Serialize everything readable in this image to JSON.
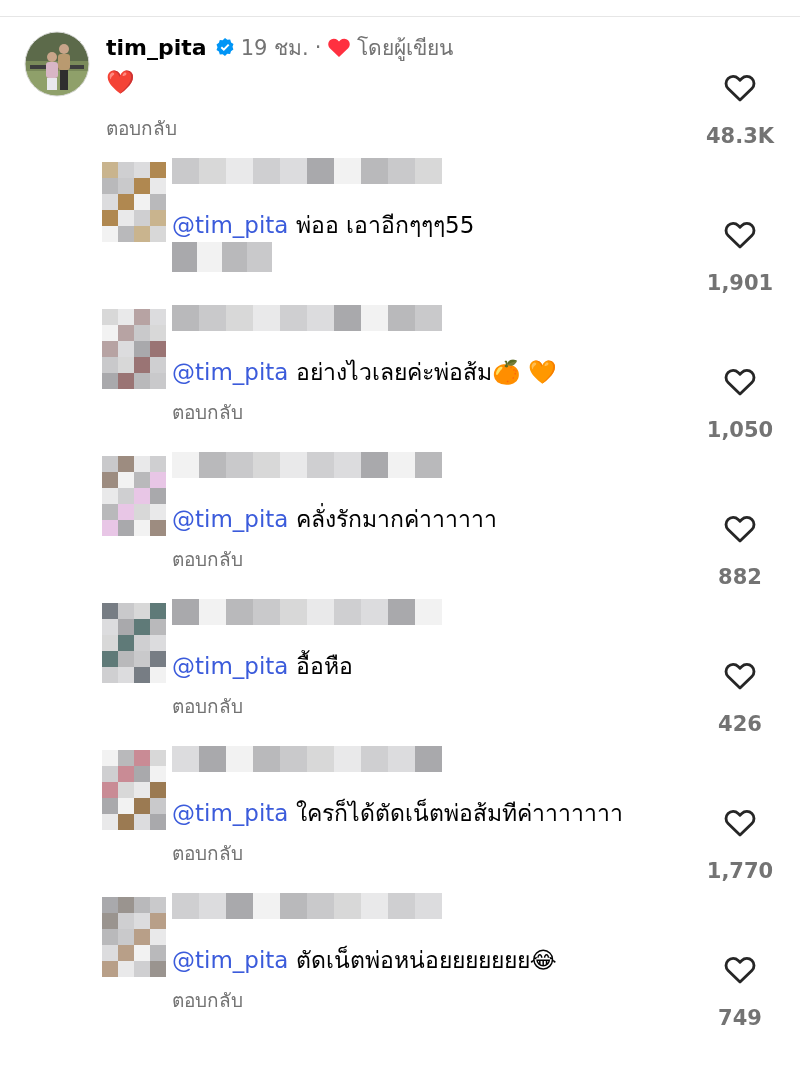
{
  "comment": {
    "username": "tim_pita",
    "verified": true,
    "time": "19 ชม.",
    "separator": "·",
    "author_liked_label": "โดยผู้เขียน",
    "text": "❤️",
    "reply_label": "ตอบกลับ",
    "likes": "48.3K",
    "liked": false
  },
  "replies": [
    {
      "mention": "@tim_pita",
      "text": "พ่ออ  เอาอีกๆๆๆ55",
      "likes": "1,901",
      "liked": false
    },
    {
      "mention": "@tim_pita",
      "text": "อย่างไวเลยค่ะพ่อส้ม🍊 🧡",
      "reply_label": "ตอบกลับ",
      "likes": "1,050",
      "liked": false
    },
    {
      "mention": "@tim_pita",
      "text": "คลั่งรักมากค่าาาาาา",
      "reply_label": "ตอบกลับ",
      "likes": "882",
      "liked": false
    },
    {
      "mention": "@tim_pita",
      "text": "อื้อหือ",
      "reply_label": "ตอบกลับ",
      "likes": "426",
      "liked": false
    },
    {
      "mention": "@tim_pita",
      "text": " ใครก็ได้ตัดเน็ตพ่อส้มทีค่าาาาาาา",
      "reply_label": "ตอบกลับ",
      "likes": "1,770",
      "liked": false
    },
    {
      "mention": "@tim_pita",
      "text": "ตัดเน็ตพ่อหน่อยยยยยยย😂",
      "reply_label": "ตอบกลับ",
      "likes": "749",
      "liked": false
    }
  ]
}
